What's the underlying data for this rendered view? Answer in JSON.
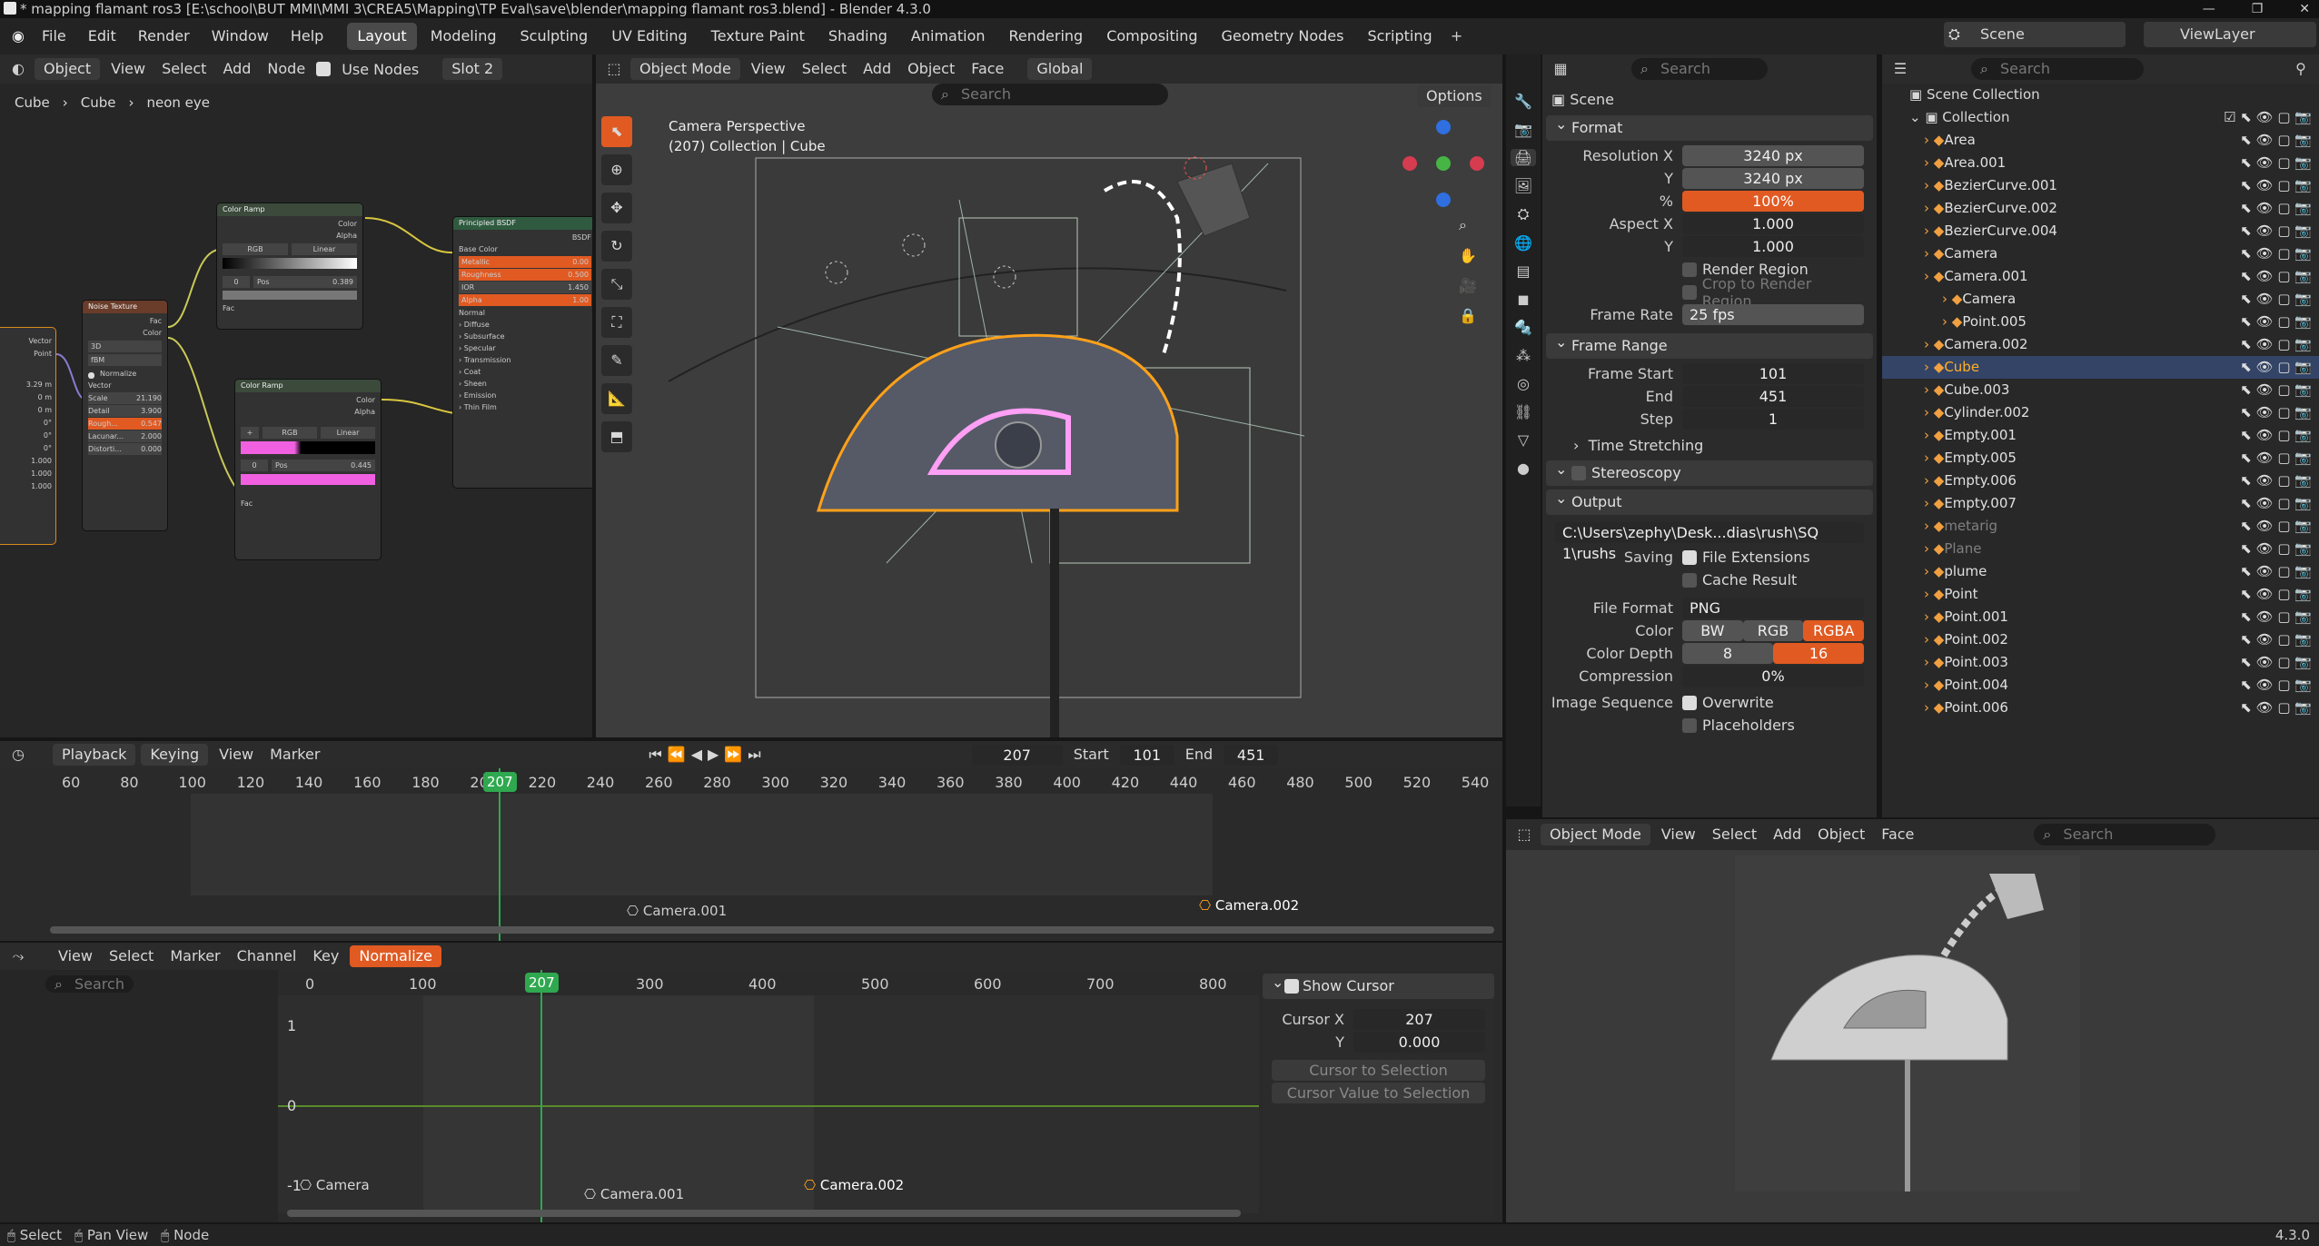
{
  "title": "* mapping flamant ros3 [E:\\school\\BUT MMI\\MMI 3\\CREA5\\Mapping\\TP Eval\\save\\blender\\mapping flamant ros3.blend] - Blender 4.3.0",
  "topmenu": [
    "File",
    "Edit",
    "Render",
    "Window",
    "Help"
  ],
  "workspaces": [
    "Layout",
    "Modeling",
    "Sculpting",
    "UV Editing",
    "Texture Paint",
    "Shading",
    "Animation",
    "Rendering",
    "Compositing",
    "Geometry Nodes",
    "Scripting"
  ],
  "scene": {
    "label": "Scene",
    "viewlayer": "ViewLayer"
  },
  "node_editor": {
    "mode": "Object",
    "menus": [
      "View",
      "Select",
      "Add",
      "Node"
    ],
    "use_nodes": "Use Nodes",
    "slot": "Slot 2",
    "breadcrumb": [
      "Cube",
      "Cube",
      "neon eye"
    ],
    "nodes": {
      "color_ramp_1": {
        "title": "Color Ramp",
        "out1": "Color",
        "out2": "Alpha",
        "mode": "RGB",
        "interp": "Linear",
        "idx": "0",
        "pos_label": "Pos",
        "pos": "0.389",
        "in": "Fac"
      },
      "color_ramp_2": {
        "title": "Color Ramp",
        "out1": "Color",
        "out2": "Alpha",
        "mode": "RGB",
        "interp": "Linear",
        "idx": "0",
        "pos_label": "Pos",
        "pos": "0.445",
        "in": "Fac"
      },
      "noise": {
        "title": "Noise Texture",
        "out1": "Fac",
        "out2": "Color",
        "dims": "3D",
        "type": "fBM",
        "normalize": "Normalize",
        "vector": "Vector",
        "scale": "Scale",
        "scale_v": "21.190",
        "detail": "Detail",
        "detail_v": "3.900",
        "rough": "Rough...",
        "rough_v": "0.547",
        "lac": "Lacunar...",
        "lac_v": "2.000",
        "dist": "Distorti...",
        "dist_v": "0.000"
      },
      "bsdf": {
        "title": "Principled BSDF",
        "out": "BSDF",
        "base": "Base Color",
        "metallic": "Metallic",
        "metallic_v": "0.00",
        "rough": "Roughness",
        "rough_v": "0.500",
        "ior": "IOR",
        "ior_v": "1.450",
        "alpha": "Alpha",
        "alpha_v": "1.00",
        "normal": "Normal",
        "subs": [
          "Diffuse",
          "Subsurface",
          "Specular",
          "Transmission",
          "Coat",
          "Sheen",
          "Emission",
          "Thin Film"
        ]
      },
      "left": {
        "vector": "Vector",
        "point": "Point",
        "vals": [
          "3.29 m",
          "0 m",
          "0 m",
          "0°",
          "0°",
          "0°",
          "1.000",
          "1.000",
          "1.000"
        ]
      }
    }
  },
  "viewport": {
    "mode": "Object Mode",
    "menus": [
      "View",
      "Select",
      "Add",
      "Object",
      "Face"
    ],
    "orient": "Global",
    "options": "Options",
    "search": "Search",
    "cam_title": "Camera Perspective",
    "cam_sub": "(207) Collection | Cube"
  },
  "props": {
    "search": "Search",
    "scene": "Scene",
    "format": {
      "title": "Format",
      "res_x_l": "Resolution X",
      "res_x": "3240 px",
      "res_y_l": "Y",
      "res_y": "3240 px",
      "pct_l": "%",
      "pct": "100%",
      "asp_x_l": "Aspect X",
      "asp_x": "1.000",
      "asp_y_l": "Y",
      "asp_y": "1.000",
      "render_region": "Render Region",
      "crop": "Crop to Render Region",
      "fr_l": "Frame Rate",
      "fr": "25 fps"
    },
    "range": {
      "title": "Frame Range",
      "start_l": "Frame Start",
      "start": "101",
      "end_l": "End",
      "end": "451",
      "step_l": "Step",
      "step": "1",
      "time_stretch": "Time Stretching",
      "stereo": "Stereoscopy"
    },
    "output": {
      "title": "Output",
      "path": "C:\\Users\\zephy\\Desk...dias\\rush\\SQ 1\\rushs",
      "saving_l": "Saving",
      "file_ext": "File Extensions",
      "cache": "Cache Result",
      "ff_l": "File Format",
      "ff": "PNG",
      "color_l": "Color",
      "bw": "BW",
      "rgb": "RGB",
      "rgba": "RGBA",
      "depth_l": "Color Depth",
      "d8": "8",
      "d16": "16",
      "comp_l": "Compression",
      "comp": "0%",
      "seq_l": "Image Sequence",
      "overwrite": "Overwrite",
      "placeholders": "Placeholders"
    }
  },
  "outliner": {
    "search": "Search",
    "scene_collection": "Scene Collection",
    "collection": "Collection",
    "items": [
      {
        "name": "Area",
        "color": "#e0e0e0"
      },
      {
        "name": "Area.001",
        "color": "#e0e0e0"
      },
      {
        "name": "BezierCurve.001",
        "color": "#e0e0e0"
      },
      {
        "name": "BezierCurve.002",
        "color": "#e0e0e0"
      },
      {
        "name": "BezierCurve.004",
        "color": "#e0e0e0"
      },
      {
        "name": "Camera",
        "color": "#e0e0e0"
      },
      {
        "name": "Camera.001",
        "color": "#e0e0e0"
      },
      {
        "name": "Camera",
        "color": "#e0e0e0"
      },
      {
        "name": "Point.005",
        "color": "#e0e0e0"
      },
      {
        "name": "Camera.002",
        "color": "#e0e0e0"
      },
      {
        "name": "Cube",
        "color": "#ffaf29"
      },
      {
        "name": "Cube.003",
        "color": "#e0e0e0"
      },
      {
        "name": "Cylinder.002",
        "color": "#e0e0e0"
      },
      {
        "name": "Empty.001",
        "color": "#e0e0e0"
      },
      {
        "name": "Empty.005",
        "color": "#e0e0e0"
      },
      {
        "name": "Empty.006",
        "color": "#e0e0e0"
      },
      {
        "name": "Empty.007",
        "color": "#e0e0e0"
      },
      {
        "name": "metarig",
        "color": "#808080"
      },
      {
        "name": "Plane",
        "color": "#808080"
      },
      {
        "name": "plume",
        "color": "#e0e0e0"
      },
      {
        "name": "Point",
        "color": "#e0e0e0"
      },
      {
        "name": "Point.001",
        "color": "#e0e0e0"
      },
      {
        "name": "Point.002",
        "color": "#e0e0e0"
      },
      {
        "name": "Point.003",
        "color": "#e0e0e0"
      },
      {
        "name": "Point.004",
        "color": "#e0e0e0"
      },
      {
        "name": "Point.006",
        "color": "#e0e0e0"
      }
    ]
  },
  "preview": {
    "mode": "Object Mode",
    "menus": [
      "View",
      "Select",
      "Add",
      "Object",
      "Face"
    ],
    "search": "Search"
  },
  "timeline": {
    "menus": [
      "Playback",
      "Keying",
      "View",
      "Marker"
    ],
    "frame": "207",
    "start_l": "Start",
    "start": "101",
    "end_l": "End",
    "end": "451",
    "ticks": [
      "60",
      "80",
      "100",
      "120",
      "140",
      "160",
      "180",
      "20",
      "220",
      "240",
      "260",
      "280",
      "300",
      "320",
      "340",
      "360",
      "380",
      "400",
      "420",
      "440",
      "460",
      "480",
      "500",
      "520",
      "540"
    ],
    "playhead": "207",
    "markers": [
      "Camera.001",
      "Camera.002"
    ]
  },
  "graph": {
    "menus": [
      "View",
      "Select",
      "Marker",
      "Channel",
      "Key"
    ],
    "normalize": "Normalize",
    "search": "Search",
    "ticks": [
      "0",
      "100",
      "300",
      "400",
      "500",
      "600",
      "700",
      "800"
    ],
    "playhead": "207",
    "y1": "1",
    "y0": "0",
    "yneg": "-1",
    "markers": [
      "Camera",
      "Camera.001",
      "Camera.002"
    ],
    "show_cursor": "Show Cursor",
    "cx_l": "Cursor X",
    "cx": "207",
    "cy_l": "Y",
    "cy": "0.000",
    "to_sel": "Cursor to Selection",
    "val_sel": "Cursor Value to Selection"
  },
  "status": {
    "items": [
      "Select",
      "Pan View",
      "Node"
    ],
    "version": "4.3.0"
  }
}
